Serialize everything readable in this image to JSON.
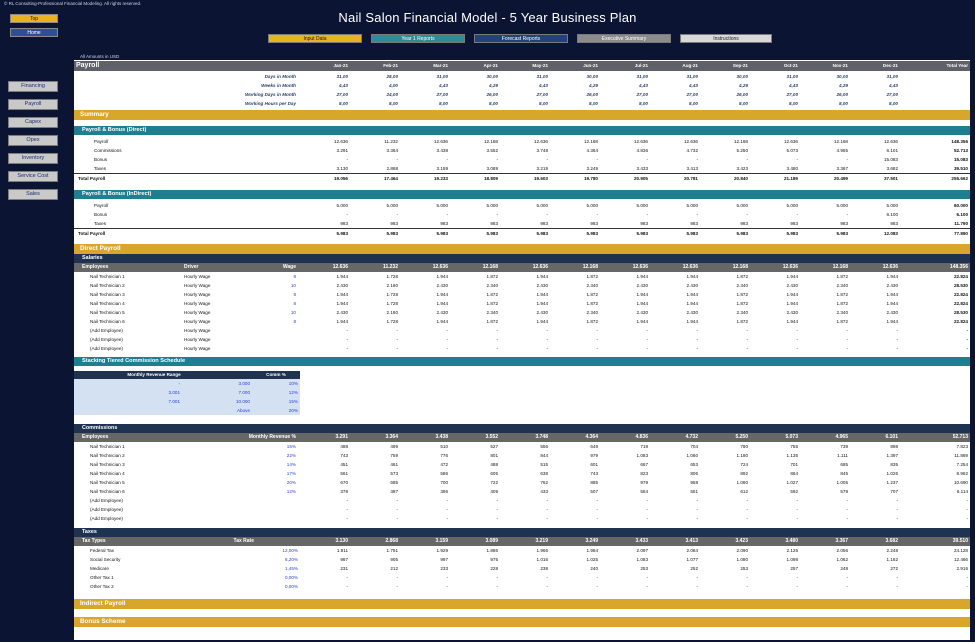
{
  "copyright": "© RL Consulting-Professional Financial Modeling. All rights reserved.",
  "title": "Nail Salon Financial Model - 5 Year Business Plan",
  "top_button": "Top",
  "home_button": "Home",
  "nav": {
    "input": "Input Data",
    "year1": "Year 1 Reports",
    "forecast": "Forecast Reports",
    "exec": "Executive Summary",
    "instructions": "Instructions"
  },
  "sidebar": [
    "Financing",
    "Payroll",
    "Capex",
    "Opex",
    "Inventory",
    "Service Cost",
    "Sales"
  ],
  "amounts_label": "All Amounts in  USD",
  "months": [
    "Jan-21",
    "Feb-21",
    "Mar-21",
    "Apr-21",
    "May-21",
    "Jun-21",
    "Jul-21",
    "Aug-21",
    "Sep-21",
    "Oct-21",
    "Nov-21",
    "Dec-21"
  ],
  "payroll_title": "Payroll",
  "total_year": "Total Year",
  "info_rows": [
    {
      "label": "Days in Month",
      "values": [
        "31,00",
        "28,00",
        "31,00",
        "30,00",
        "31,00",
        "30,00",
        "31,00",
        "31,00",
        "30,00",
        "31,00",
        "30,00",
        "31,00"
      ]
    },
    {
      "label": "Weeks in Month",
      "values": [
        "4,43",
        "4,00",
        "4,43",
        "4,29",
        "4,43",
        "4,29",
        "4,43",
        "4,43",
        "4,29",
        "4,43",
        "4,29",
        "4,43"
      ]
    },
    {
      "label": "Working Days in Month",
      "values": [
        "27,00",
        "24,00",
        "27,00",
        "26,00",
        "27,00",
        "26,00",
        "27,00",
        "27,00",
        "26,00",
        "27,00",
        "26,00",
        "27,00"
      ]
    },
    {
      "label": "Working Hours per Day",
      "values": [
        "8,00",
        "8,00",
        "8,00",
        "8,00",
        "8,00",
        "8,00",
        "8,00",
        "8,00",
        "8,00",
        "8,00",
        "8,00",
        "8,00"
      ]
    }
  ],
  "summary_title": "Summary",
  "direct_section": {
    "title": "Payroll & Bonus (Direct)",
    "rows": [
      {
        "label": "Payroll",
        "values": [
          "12.636",
          "11.232",
          "12.636",
          "12.168",
          "12.636",
          "12.168",
          "12.636",
          "12.636",
          "12.168",
          "12.636",
          "12.168",
          "12.636"
        ],
        "total": "148.356"
      },
      {
        "label": "Commissions",
        "values": [
          "3.291",
          "3.364",
          "3.438",
          "3.552",
          "3.748",
          "4.364",
          "4.836",
          "4.732",
          "5.250",
          "5.073",
          "4.965",
          "6.101"
        ],
        "total": "52.713"
      },
      {
        "label": "Bonus",
        "values": [
          "-",
          "-",
          "-",
          "-",
          "-",
          "-",
          "-",
          "-",
          "-",
          "-",
          "-",
          "15.083"
        ],
        "total": "15.083"
      },
      {
        "label": "Taxes",
        "values": [
          "3.130",
          "2.868",
          "3.159",
          "3.089",
          "3.219",
          "3.249",
          "3.433",
          "3.413",
          "3.423",
          "3.480",
          "3.367",
          "3.682"
        ],
        "total": "39.510"
      }
    ],
    "total": {
      "label": "Total Payroll",
      "values": [
        "19.056",
        "17.464",
        "19.233",
        "18.809",
        "19.603",
        "19.780",
        "20.905",
        "20.781",
        "20.840",
        "21.189",
        "20.499",
        "37.501"
      ],
      "total": "255.662"
    }
  },
  "indirect_section": {
    "title": "Payroll & Bonus (InDirect)",
    "rows": [
      {
        "label": "Payroll",
        "values": [
          "5.000",
          "5.000",
          "5.000",
          "5.000",
          "5.000",
          "5.000",
          "5.000",
          "5.000",
          "5.000",
          "5.000",
          "5.000",
          "5.000"
        ],
        "total": "60.000"
      },
      {
        "label": "Bonus",
        "values": [
          "-",
          "-",
          "-",
          "-",
          "-",
          "-",
          "-",
          "-",
          "-",
          "-",
          "-",
          "6.100"
        ],
        "total": "6.100"
      },
      {
        "label": "Taxes",
        "values": [
          "983",
          "983",
          "983",
          "983",
          "983",
          "983",
          "983",
          "983",
          "983",
          "983",
          "983",
          "983"
        ],
        "total": "11.790"
      }
    ],
    "total": {
      "label": "Total Payroll",
      "values": [
        "5.983",
        "5.983",
        "5.983",
        "5.983",
        "5.983",
        "5.983",
        "5.983",
        "5.983",
        "5.983",
        "5.983",
        "5.983",
        "12.083"
      ],
      "total": "77.890"
    }
  },
  "direct_payroll_title": "Direct Payroll",
  "salaries": {
    "title": "Salaries",
    "headers": {
      "employees": "Employees",
      "driver": "Driver",
      "wage": "Wage"
    },
    "header_values": [
      "12.636",
      "11.232",
      "12.636",
      "12.168",
      "12.636",
      "12.168",
      "12.636",
      "12.636",
      "12.168",
      "12.636",
      "12.168",
      "12.636"
    ],
    "header_total": "148.356",
    "rows": [
      {
        "name": "Nail Technician 1",
        "driver": "Hourly Wage",
        "wage": "8",
        "values": [
          "1.944",
          "1.728",
          "1.944",
          "1.872",
          "1.944",
          "1.872",
          "1.944",
          "1.944",
          "1.872",
          "1.944",
          "1.872",
          "1.944"
        ],
        "total": "22.824"
      },
      {
        "name": "Nail Technician 2",
        "driver": "Hourly Wage",
        "wage": "10",
        "values": [
          "2.430",
          "2.160",
          "2.430",
          "2.340",
          "2.430",
          "2.340",
          "2.430",
          "2.430",
          "2.340",
          "2.430",
          "2.340",
          "2.430"
        ],
        "total": "28.530"
      },
      {
        "name": "Nail Technician 3",
        "driver": "Hourly Wage",
        "wage": "8",
        "values": [
          "1.944",
          "1.728",
          "1.944",
          "1.872",
          "1.944",
          "1.872",
          "1.944",
          "1.944",
          "1.872",
          "1.944",
          "1.872",
          "1.944"
        ],
        "total": "22.824"
      },
      {
        "name": "Nail Technician 4",
        "driver": "Hourly Wage",
        "wage": "8",
        "values": [
          "1.944",
          "1.728",
          "1.944",
          "1.872",
          "1.944",
          "1.872",
          "1.944",
          "1.944",
          "1.872",
          "1.944",
          "1.872",
          "1.944"
        ],
        "total": "22.824"
      },
      {
        "name": "Nail Technician 5",
        "driver": "Hourly Wage",
        "wage": "10",
        "values": [
          "2.430",
          "2.160",
          "2.430",
          "2.340",
          "2.430",
          "2.340",
          "2.430",
          "2.430",
          "2.340",
          "2.430",
          "2.340",
          "2.430"
        ],
        "total": "28.530"
      },
      {
        "name": "Nail Technician 6",
        "driver": "Hourly Wage",
        "wage": "8",
        "values": [
          "1.944",
          "1.728",
          "1.944",
          "1.872",
          "1.944",
          "1.872",
          "1.944",
          "1.944",
          "1.872",
          "1.944",
          "1.872",
          "1.944"
        ],
        "total": "22.824"
      },
      {
        "name": "(Add Employee)",
        "driver": "Hourly Wage",
        "wage": "",
        "values": [
          "-",
          "-",
          "-",
          "-",
          "-",
          "-",
          "-",
          "-",
          "-",
          "-",
          "-",
          "-"
        ],
        "total": "-"
      },
      {
        "name": "(Add Employee)",
        "driver": "Hourly Wage",
        "wage": "",
        "values": [
          "-",
          "-",
          "-",
          "-",
          "-",
          "-",
          "-",
          "-",
          "-",
          "-",
          "-",
          "-"
        ],
        "total": "-"
      },
      {
        "name": "(Add Employee)",
        "driver": "Hourly Wage",
        "wage": "",
        "values": [
          "-",
          "-",
          "-",
          "-",
          "-",
          "-",
          "-",
          "-",
          "-",
          "-",
          "-",
          "-"
        ],
        "total": "-"
      }
    ]
  },
  "tiered": {
    "title": "Stacking Tiered Commission Schedule",
    "headers": {
      "range": "Monthly Revenue Range",
      "comm": "Comm %"
    },
    "rows": [
      {
        "from": "-",
        "to": "3.000",
        "pct": "10%"
      },
      {
        "from": "3.001",
        "to": "7.000",
        "pct": "12%"
      },
      {
        "from": "7.001",
        "to": "10.000",
        "pct": "15%"
      },
      {
        "from": "",
        "to": "Above",
        "pct": "20%"
      }
    ]
  },
  "commissions": {
    "title": "Commissions",
    "headers": {
      "employees": "Employees",
      "rev": "Monthly Revenue %"
    },
    "header_values": [
      "3.291",
      "3.364",
      "3.438",
      "3.552",
      "3.748",
      "4.364",
      "4.836",
      "4.732",
      "5.250",
      "5.073",
      "4.965",
      "6.101"
    ],
    "header_total": "52.713",
    "rows": [
      {
        "name": "Nail Technician 1",
        "pct": "15%",
        "values": [
          "488",
          "499",
          "510",
          "527",
          "556",
          "649",
          "719",
          "704",
          "780",
          "755",
          "739",
          "898"
        ],
        "total": "7.823"
      },
      {
        "name": "Nail Technician 2",
        "pct": "22%",
        "values": [
          "743",
          "759",
          "776",
          "801",
          "844",
          "979",
          "1.083",
          "1.060",
          "1.180",
          "1.135",
          "1.111",
          "1.397"
        ],
        "total": "11.869"
      },
      {
        "name": "Nail Technician 3",
        "pct": "14%",
        "values": [
          "451",
          "461",
          "472",
          "488",
          "515",
          "601",
          "667",
          "653",
          "724",
          "701",
          "685",
          "835"
        ],
        "total": "7.254"
      },
      {
        "name": "Nail Technician 4",
        "pct": "17%",
        "values": [
          "561",
          "573",
          "586",
          "605",
          "638",
          "743",
          "823",
          "806",
          "892",
          "864",
          "845",
          "1.026"
        ],
        "total": "8.962"
      },
      {
        "name": "Nail Technician 5",
        "pct": "20%",
        "values": [
          "670",
          "685",
          "700",
          "722",
          "762",
          "885",
          "979",
          "958",
          "1.060",
          "1.027",
          "1.005",
          "1.237"
        ],
        "total": "10.690"
      },
      {
        "name": "Nail Technician 6",
        "pct": "12%",
        "values": [
          "378",
          "387",
          "396",
          "409",
          "433",
          "507",
          "564",
          "551",
          "612",
          "592",
          "579",
          "707"
        ],
        "total": "6.114"
      },
      {
        "name": "(Add Employee)",
        "pct": "",
        "values": [
          "-",
          "-",
          "-",
          "-",
          "-",
          "-",
          "-",
          "-",
          "-",
          "-",
          "-",
          "-"
        ],
        "total": "-"
      },
      {
        "name": "(Add Employee)",
        "pct": "",
        "values": [
          "-",
          "-",
          "-",
          "-",
          "-",
          "-",
          "-",
          "-",
          "-",
          "-",
          "-",
          "-"
        ],
        "total": "-"
      },
      {
        "name": "(Add Employee)",
        "pct": "",
        "values": [
          "-",
          "-",
          "-",
          "-",
          "-",
          "-",
          "-",
          "-",
          "-",
          "-",
          "-",
          "-"
        ],
        "total": "-"
      }
    ]
  },
  "taxes": {
    "title": "Taxes",
    "headers": {
      "types": "Tax Types",
      "rate": "Tax Rate"
    },
    "header_values": [
      "3.130",
      "2.868",
      "3.159",
      "3.089",
      "3.219",
      "3.249",
      "3.433",
      "3.413",
      "3.423",
      "3.480",
      "3.367",
      "3.682"
    ],
    "header_total": "39.510",
    "rows": [
      {
        "name": "Federal Tax",
        "rate": "12,00%",
        "values": [
          "1.911",
          "1.751",
          "1.929",
          "1.886",
          "1.966",
          "1.984",
          "2.097",
          "2.084",
          "2.090",
          "2.125",
          "2.056",
          "2.248"
        ],
        "total": "24.128"
      },
      {
        "name": "Social Security",
        "rate": "6,20%",
        "values": [
          "987",
          "905",
          "997",
          "975",
          "1.016",
          "1.025",
          "1.083",
          "1.077",
          "1.080",
          "1.098",
          "1.062",
          "1.162"
        ],
        "total": "12.466"
      },
      {
        "name": "Medicare",
        "rate": "1,45%",
        "values": [
          "231",
          "212",
          "233",
          "228",
          "238",
          "240",
          "253",
          "252",
          "253",
          "257",
          "248",
          "272"
        ],
        "total": "2.916"
      },
      {
        "name": "Other Tax 1",
        "rate": "0,00%",
        "values": [
          "-",
          "-",
          "-",
          "-",
          "-",
          "-",
          "-",
          "-",
          "-",
          "-",
          "-",
          "-"
        ],
        "total": "-"
      },
      {
        "name": "Other Tax 2",
        "rate": "0,00%",
        "values": [
          "-",
          "-",
          "-",
          "-",
          "-",
          "-",
          "-",
          "-",
          "-",
          "-",
          "-",
          "-"
        ],
        "total": "-"
      }
    ]
  },
  "indirect_payroll_title": "Indirect Payroll",
  "bonus_scheme_title": "Bonus Scheme"
}
